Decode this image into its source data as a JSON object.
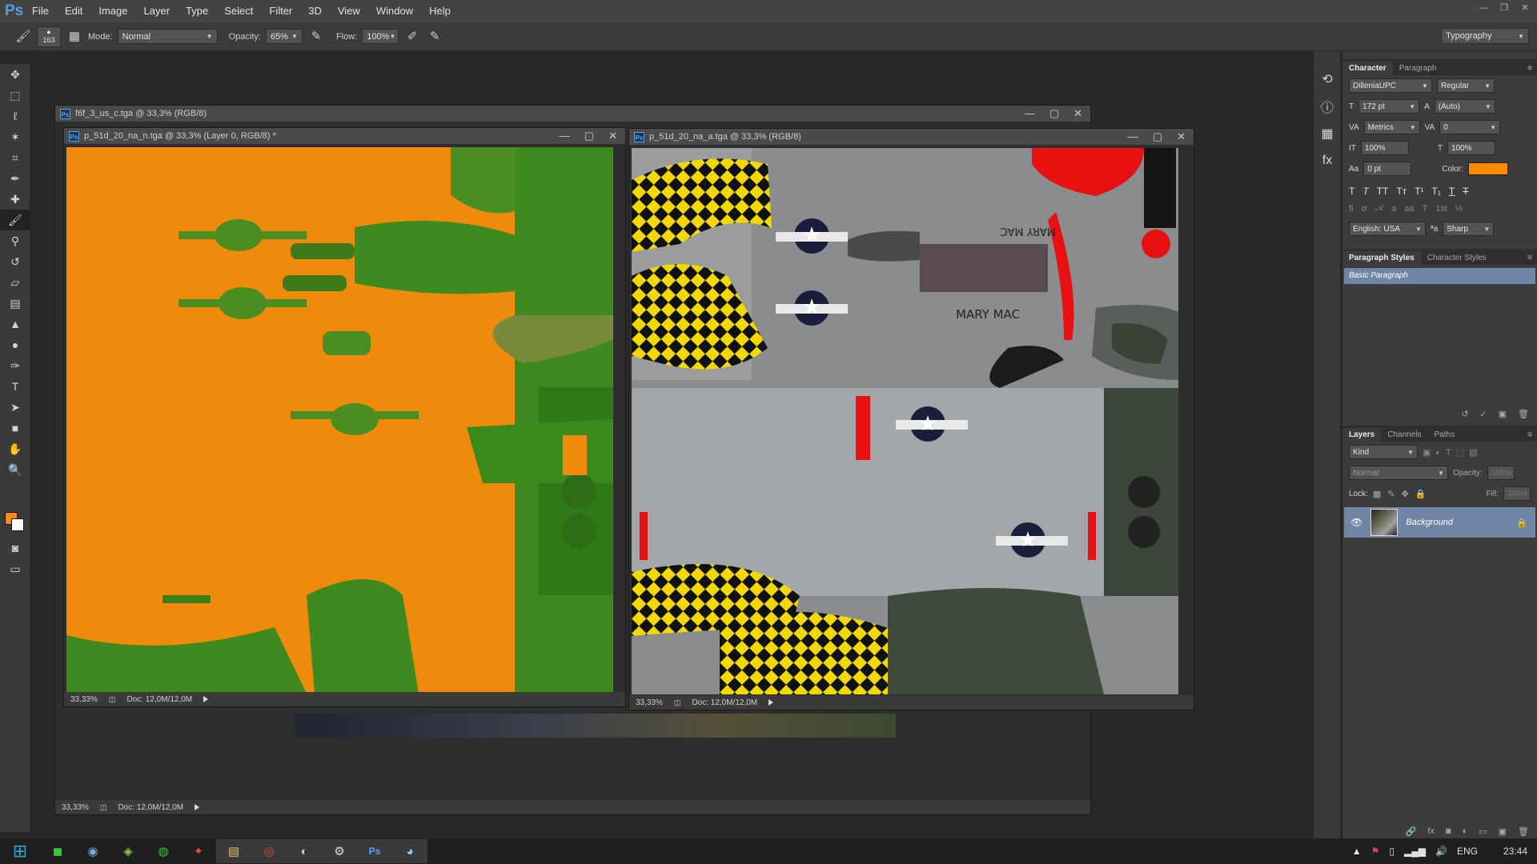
{
  "app": {
    "logo": "Ps"
  },
  "menu": [
    "File",
    "Edit",
    "Image",
    "Layer",
    "Type",
    "Select",
    "Filter",
    "3D",
    "View",
    "Window",
    "Help"
  ],
  "options": {
    "brush_size": "163",
    "mode_label": "Mode:",
    "mode_value": "Normal",
    "opacity_label": "Opacity:",
    "opacity_value": "65%",
    "flow_label": "Flow:",
    "flow_value": "100%",
    "workspace": "Typography"
  },
  "documents": {
    "back": {
      "title": "f6f_3_us_c.tga @ 33,3% (RGB/8)",
      "zoom": "33,33%",
      "doc_size": "Doc: 12,0M/12,0M"
    },
    "left": {
      "title": "p_51d_20_na_n.tga @ 33,3% (Layer 0, RGB/8) *",
      "zoom": "33,33%",
      "doc_size": "Doc: 12,0M/12,0M"
    },
    "right": {
      "title": "p_51d_20_na_a.tga @ 33,3% (RGB/8)",
      "zoom": "33,33%",
      "doc_size": "Doc: 12,0M/12,0M",
      "texture_text": [
        "MARY MAC",
        "MARY MAC"
      ]
    }
  },
  "character_panel": {
    "tabs": [
      "Character",
      "Paragraph"
    ],
    "font_family": "DilleniaUPC",
    "font_style": "Regular",
    "font_size": "172 pt",
    "leading": "(Auto)",
    "kerning": "Metrics",
    "tracking": "0",
    "vertical_scale": "100%",
    "horizontal_scale": "100%",
    "baseline_shift": "0 pt",
    "color_label": "Color:",
    "color": "#ff8a00",
    "language": "English: USA",
    "antialias": "Sharp"
  },
  "styles_panel": {
    "tabs": [
      "Paragraph Styles",
      "Character Styles"
    ],
    "selected": "Basic Paragraph"
  },
  "layers_panel": {
    "tabs": [
      "Layers",
      "Channels",
      "Paths"
    ],
    "filter": "Kind",
    "blend": "Normal",
    "opacity_label": "Opacity:",
    "opacity": "100%",
    "lock_label": "Lock:",
    "fill_label": "Fill:",
    "fill": "100%",
    "layer_name": "Background"
  },
  "taskbar": {
    "lang": "ENG",
    "time": "23:44"
  }
}
